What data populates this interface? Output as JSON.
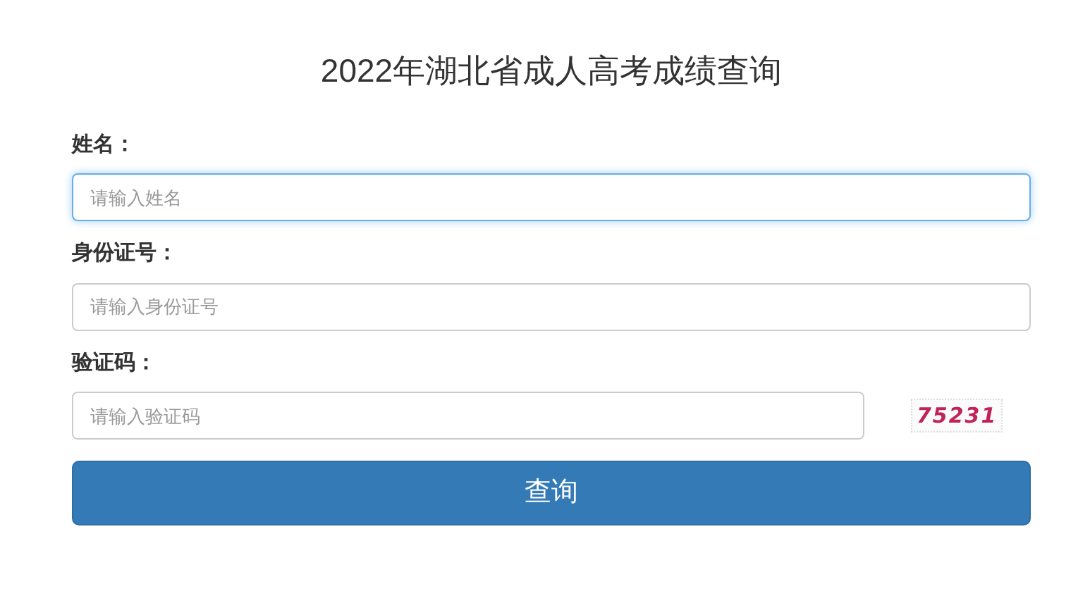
{
  "title": "2022年湖北省成人高考成绩查询",
  "fields": [
    {
      "label": "姓名：",
      "placeholder": "请输入姓名",
      "focused": true
    },
    {
      "label": "身份证号：",
      "placeholder": "请输入身份证号",
      "focused": false
    },
    {
      "label": "验证码：",
      "placeholder": "请输入验证码",
      "focused": false,
      "captcha": "75231"
    }
  ],
  "submit": "查询"
}
